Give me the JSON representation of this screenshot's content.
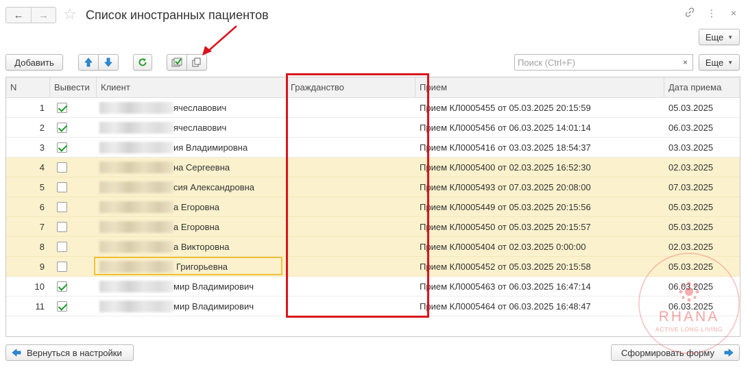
{
  "window": {
    "title": "Список иностранных пациентов",
    "back_icon": "arrow-left-icon",
    "forward_icon": "arrow-right-icon",
    "favorite_icon": "star-icon",
    "top_icons": [
      "link-icon",
      "more-vertical-icon",
      "close-icon"
    ]
  },
  "toolbar": {
    "more_top": "Еще",
    "add_label": "Добавить",
    "move_up_icon": "arrow-up-icon",
    "move_down_icon": "arrow-down-icon",
    "refresh_icon": "refresh-icon",
    "check_all_icon": "check-all-icon",
    "copy_icon": "copy-icon",
    "search_placeholder": "Поиск (Ctrl+F)",
    "search_value": "",
    "search_clear": "×",
    "more_label": "Еще"
  },
  "table": {
    "columns": [
      "N",
      "Вывести",
      "Клиент",
      "Гражданство",
      "Прием",
      "Дата приема"
    ],
    "rows": [
      {
        "n": "1",
        "checked": true,
        "client": "ячеславович",
        "citizenship": "",
        "visit": "Прием КЛ0005455 от 05.03.2025 20:15:59",
        "date": "05.03.2025",
        "highlight": false
      },
      {
        "n": "2",
        "checked": true,
        "client": "ячеславович",
        "citizenship": "",
        "visit": "Прием КЛ0005456 от 06.03.2025 14:01:14",
        "date": "06.03.2025",
        "highlight": false
      },
      {
        "n": "3",
        "checked": true,
        "client": "ия Владимировна",
        "citizenship": "",
        "visit": "Прием КЛ0005416 от 03.03.2025 18:54:37",
        "date": "03.03.2025",
        "highlight": false
      },
      {
        "n": "4",
        "checked": false,
        "client": "на Сергеевна",
        "citizenship": "",
        "visit": "Прием КЛ0005400 от 02.03.2025 16:52:30",
        "date": "02.03.2025",
        "highlight": true
      },
      {
        "n": "5",
        "checked": false,
        "client": "сия Александровна",
        "citizenship": "",
        "visit": "Прием КЛ0005493 от 07.03.2025 20:08:00",
        "date": "07.03.2025",
        "highlight": true
      },
      {
        "n": "6",
        "checked": false,
        "client": "а Егоровна",
        "citizenship": "",
        "visit": "Прием КЛ0005449 от 05.03.2025 20:15:56",
        "date": "05.03.2025",
        "highlight": true
      },
      {
        "n": "7",
        "checked": false,
        "client": "а Егоровна",
        "citizenship": "",
        "visit": "Прием КЛ0005450 от 05.03.2025 20:15:57",
        "date": "05.03.2025",
        "highlight": true
      },
      {
        "n": "8",
        "checked": false,
        "client": "а Викторовна",
        "citizenship": "",
        "visit": "Прием КЛ0005404 от 02.03.2025 0:00:00",
        "date": "02.03.2025",
        "highlight": true
      },
      {
        "n": "9",
        "checked": false,
        "client": "Григорьевна",
        "citizenship": "",
        "visit": "Прием КЛ0005452 от 05.03.2025 20:15:58",
        "date": "05.03.2025",
        "highlight": true
      },
      {
        "n": "10",
        "checked": true,
        "client": "мир Владимирович",
        "citizenship": "",
        "visit": "Прием КЛ0005463 от 06.03.2025 16:47:14",
        "date": "06.03.2025",
        "highlight": false
      },
      {
        "n": "11",
        "checked": true,
        "client": "мир Владимирович",
        "citizenship": "",
        "visit": "Прием КЛ0005464 от 06.03.2025 16:48:47",
        "date": "06.03.2025",
        "highlight": false
      }
    ]
  },
  "footer": {
    "back_label": "Вернуться в настройки",
    "submit_label": "Сформировать форму"
  },
  "watermark": {
    "brand": "RHANA",
    "tagline": "ACTIVE LONG LIVING"
  },
  "colors": {
    "highlight_row": "#fbf1cd",
    "annotation_red": "#d9141c",
    "selection_border": "#f0c23a",
    "check_green": "#1a9a2a",
    "nav_blue": "#2a8ad8"
  }
}
